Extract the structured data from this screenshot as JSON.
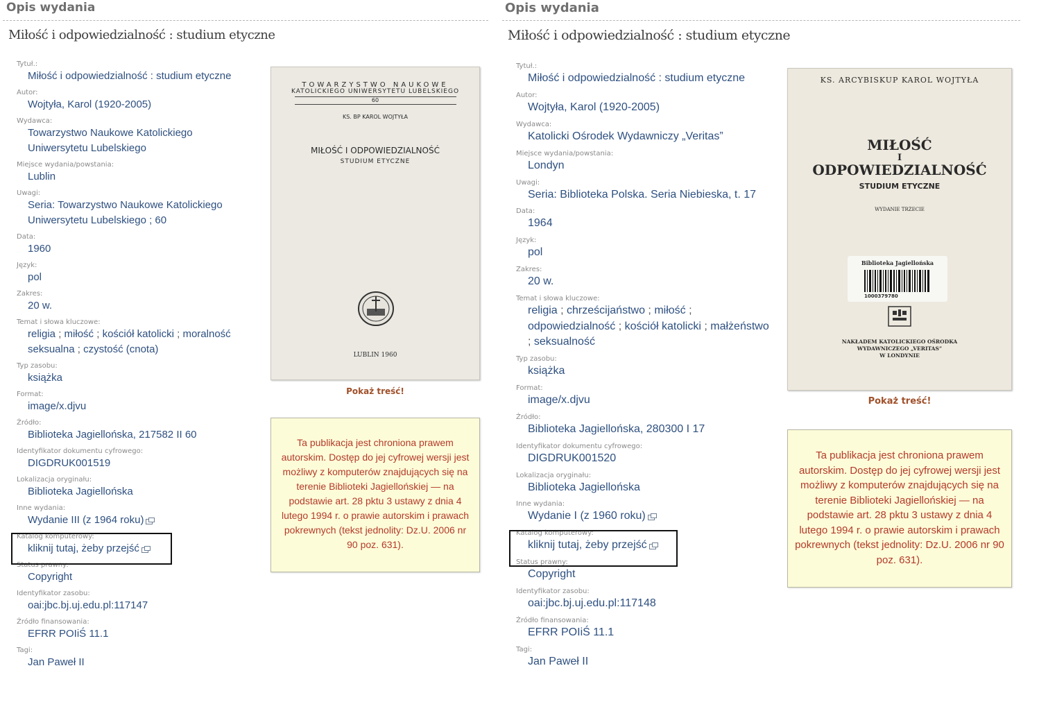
{
  "left": {
    "section_title": "Opis wydania",
    "work_title": "Miłość i odpowiedzialność : studium etyczne",
    "fields": {
      "title": {
        "label": "Tytuł.:",
        "value": "Miłość i odpowiedzialność : studium etyczne"
      },
      "author": {
        "label": "Autor:",
        "value": "Wojtyła, Karol (1920-2005)"
      },
      "publisher": {
        "label": "Wydawca:",
        "line1": "Towarzystwo Naukowe Katolickiego",
        "line2": "Uniwersytetu Lubelskiego"
      },
      "place": {
        "label": "Miejsce wydania/powstania:",
        "value": "Lublin"
      },
      "notes": {
        "label": "Uwagi:",
        "line1": "Seria: Towarzystwo Naukowe Katolickiego",
        "line2": "Uniwersytetu Lubelskiego ; 60"
      },
      "date": {
        "label": "Data:",
        "value": "1960"
      },
      "language": {
        "label": "Język:",
        "value": "pol"
      },
      "extent": {
        "label": "Zakres:",
        "value": "20 w."
      },
      "subjects": {
        "label": "Temat i słowa kluczowe:",
        "items": [
          "religia",
          "miłość",
          "kościół katolicki",
          "moralność",
          "seksualna",
          "czystość (cnota)"
        ],
        "sep": " ; "
      },
      "type": {
        "label": "Typ zasobu:",
        "value": "książka"
      },
      "format": {
        "label": "Format:",
        "value": "image/x.djvu"
      },
      "source": {
        "label": "Źródło:",
        "value": "Biblioteka Jagiellońska, 217582 II 60"
      },
      "digital_id": {
        "label": "Identyfikator dokumentu cyfrowego:",
        "value": "DIGDRUK001519"
      },
      "location": {
        "label": "Lokalizacja oryginału:",
        "value": "Biblioteka Jagiellońska"
      },
      "other_editions": {
        "label": "Inne wydania:",
        "value": "Wydanie III (z 1964 roku)"
      },
      "catalog": {
        "label": "Katalog komputerowy:",
        "value": "kliknij tutaj, żeby przejść"
      },
      "legal_status": {
        "label": "Status prawny:",
        "value": "Copyright"
      },
      "resource_id": {
        "label": "Identyfikator zasobu:",
        "value": "oai:jbc.bj.uj.edu.pl:117147"
      },
      "funding": {
        "label": "Źródło finansowania:",
        "value": "EFRR POIiŚ 11.1"
      },
      "tags": {
        "label": "Tagi:",
        "value": "Jan Paweł II"
      }
    },
    "cover": {
      "society_l1": "TOWARZYSTWO NAUKOWE",
      "society_l2": "KATOLICKIEGO UNIWERSYTETU LUBELSKIEGO",
      "series_no": "60",
      "author": "KS. BP KAROL WOJTYŁA",
      "title": "MIŁOŚĆ I ODPOWIEDZIALNOŚĆ",
      "subtitle": "STUDIUM ETYCZNE",
      "imprint": "LUBLIN 1960"
    },
    "show_content": "Pokaż treść!",
    "notice": "Ta publikacja jest chroniona prawem autorskim. Dostęp do jej cyfrowej wersji jest możliwy z komputerów znajdujących się na terenie Biblioteki Jagiellońskiej — na podstawie art. 28 pktu 3 ustawy z dnia 4 lutego 1994 r. o prawie autorskim i prawach pokrewnych (tekst jednolity: Dz.U. 2006 nr 90 poz. 631)."
  },
  "right": {
    "section_title": "Opis wydania",
    "work_title": "Miłość i odpowiedzialność : studium etyczne",
    "fields": {
      "title": {
        "label": "Tytuł.:",
        "value": "Miłość i odpowiedzialność : studium etyczne"
      },
      "author": {
        "label": "Autor:",
        "value": "Wojtyła, Karol (1920-2005)"
      },
      "publisher": {
        "label": "Wydawca:",
        "value": "Katolicki Ośrodek Wydawniczy „Veritas”"
      },
      "place": {
        "label": "Miejsce wydania/powstania:",
        "value": "Londyn"
      },
      "notes": {
        "label": "Uwagi:",
        "value": "Seria: Biblioteka Polska. Seria Niebieska, t. 17"
      },
      "date": {
        "label": "Data:",
        "value": "1964"
      },
      "language": {
        "label": "Język:",
        "value": "pol"
      },
      "extent": {
        "label": "Zakres:",
        "value": "20 w."
      },
      "subjects": {
        "label": "Temat i słowa kluczowe:",
        "items": [
          "religia",
          "chrześcijaństwo",
          "miłość",
          "odpowiedzialność",
          "kościół katolicki",
          "małżeństwo",
          "seksualność"
        ],
        "sep": " ; "
      },
      "type": {
        "label": "Typ zasobu:",
        "value": "książka"
      },
      "format": {
        "label": "Format:",
        "value": "image/x.djvu"
      },
      "source": {
        "label": "Źródło:",
        "value": "Biblioteka Jagiellońska, 280300 I 17"
      },
      "digital_id": {
        "label": "Identyfikator dokumentu cyfrowego:",
        "value": "DIGDRUK001520"
      },
      "location": {
        "label": "Lokalizacja oryginału:",
        "value": "Biblioteka Jagiellońska"
      },
      "other_editions": {
        "label": "Inne wydania:",
        "value": "Wydanie I (z 1960 roku)"
      },
      "catalog": {
        "label": "Katalog komputerowy:",
        "value": "kliknij tutaj, żeby przejść"
      },
      "legal_status": {
        "label": "Status prawny:",
        "value": "Copyright"
      },
      "resource_id": {
        "label": "Identyfikator zasobu:",
        "value": "oai:jbc.bj.uj.edu.pl:117148"
      },
      "funding": {
        "label": "Źródło finansowania:",
        "value": "EFRR POIiŚ 11.1"
      },
      "tags": {
        "label": "Tagi:",
        "value": "Jan Paweł II"
      }
    },
    "cover": {
      "author": "KS. ARCYBISKUP KAROL WOJTYŁA",
      "title_l1": "MIŁOŚĆ",
      "title_l2": "I",
      "title_l3": "ODPOWIEDZIALNOŚĆ",
      "subtitle": "STUDIUM ETYCZNE",
      "edition": "WYDANIE TRZECIE",
      "stamp_label": "Biblioteka Jagiellońska",
      "barcode_no": "1000379780",
      "imprint_l1": "NAKŁADEM KATOLICKIEGO OŚRODKA",
      "imprint_l2": "WYDAWNICZEGO „VERITAS”",
      "imprint_l3": "W LONDYNIE"
    },
    "show_content": "Pokaż treść!",
    "notice": "Ta publikacja jest chroniona prawem autorskim. Dostęp do jej cyfrowej wersji jest możliwy z komputerów znajdujących się na terenie Biblioteki Jagiellońskiej — na podstawie art. 28 pktu 3 ustawy z dnia 4 lutego 1994 r. o prawie autorskim i prawach pokrewnych (tekst jednolity: Dz.U. 2006 nr 90 poz. 631)."
  },
  "colors": {
    "link": "#2e5080",
    "label": "#8a8a8a",
    "notice_text": "#b33a2a",
    "notice_bg": "#fdfcd8",
    "show_link": "#a0502a"
  }
}
